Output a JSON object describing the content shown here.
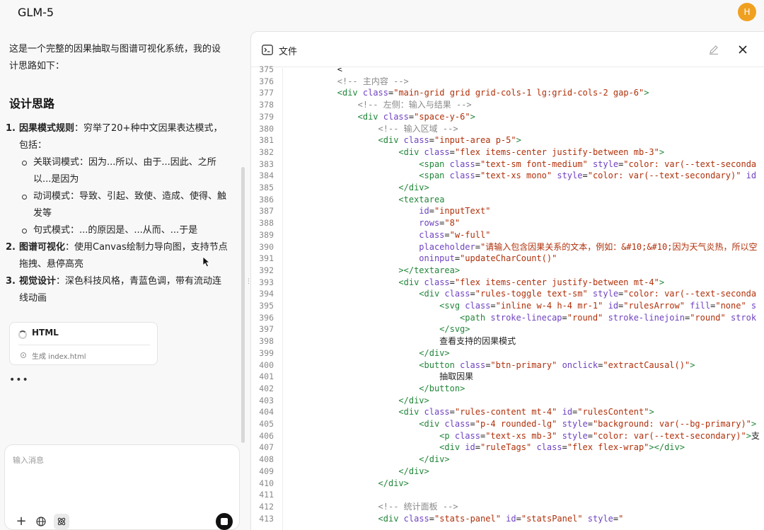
{
  "app": {
    "title": "GLM-5",
    "avatar_letter": "H"
  },
  "chat": {
    "intro": "这是一个完整的因果抽取与图谱可视化系统，我的设计思路如下：",
    "heading": "设计思路",
    "items": [
      {
        "num": "1.",
        "title": "因果模式规则",
        "text": "：穷举了20+种中文因果表达模式，包括：",
        "subs": [
          "关联词模式：因为...所以、由于...因此、之所以...是因为",
          "动词模式：导致、引起、致使、造成、使得、触发等",
          "句式模式：...的原因是、...从而、...于是"
        ]
      },
      {
        "num": "2.",
        "title": "图谱可视化",
        "text": "：使用Canvas绘制力导向图，支持节点拖拽、悬停高亮",
        "subs": []
      },
      {
        "num": "3.",
        "title": "视觉设计",
        "text": "：深色科技风格，青蓝色调，带有流动连线动画",
        "subs": []
      }
    ],
    "card": {
      "title": "HTML",
      "status": "生成 index.html"
    },
    "typing": "•••",
    "input_placeholder": "输入消息"
  },
  "panel": {
    "title": "文件",
    "lines": [
      {
        "n": "375",
        "indent": 8,
        "tokens": [
          [
            "c-txt",
            "<"
          ]
        ]
      },
      {
        "n": "376",
        "indent": 8,
        "tokens": [
          [
            "c-com",
            "<!-- 主内容 -->"
          ]
        ]
      },
      {
        "n": "377",
        "indent": 8,
        "tokens": [
          [
            "c-tag",
            "<div "
          ],
          [
            "c-attr",
            "class"
          ],
          [
            "c-txt",
            "="
          ],
          [
            "c-str",
            "\"main-grid grid grid-cols-1 lg:grid-cols-2 gap-6\""
          ],
          [
            "c-tag",
            ">"
          ]
        ]
      },
      {
        "n": "378",
        "indent": 12,
        "tokens": [
          [
            "c-com",
            "<!-- 左侧：输入与结果 -->"
          ]
        ]
      },
      {
        "n": "379",
        "indent": 12,
        "tokens": [
          [
            "c-tag",
            "<div "
          ],
          [
            "c-attr",
            "class"
          ],
          [
            "c-txt",
            "="
          ],
          [
            "c-str",
            "\"space-y-6\""
          ],
          [
            "c-tag",
            ">"
          ]
        ]
      },
      {
        "n": "380",
        "indent": 16,
        "tokens": [
          [
            "c-com",
            "<!-- 输入区域 -->"
          ]
        ]
      },
      {
        "n": "381",
        "indent": 16,
        "tokens": [
          [
            "c-tag",
            "<div "
          ],
          [
            "c-attr",
            "class"
          ],
          [
            "c-txt",
            "="
          ],
          [
            "c-str",
            "\"input-area p-5\""
          ],
          [
            "c-tag",
            ">"
          ]
        ]
      },
      {
        "n": "382",
        "indent": 20,
        "tokens": [
          [
            "c-tag",
            "<div "
          ],
          [
            "c-attr",
            "class"
          ],
          [
            "c-txt",
            "="
          ],
          [
            "c-str",
            "\"flex items-center justify-between mb-3\""
          ],
          [
            "c-tag",
            ">"
          ]
        ]
      },
      {
        "n": "383",
        "indent": 24,
        "tokens": [
          [
            "c-tag",
            "<span "
          ],
          [
            "c-attr",
            "class"
          ],
          [
            "c-txt",
            "="
          ],
          [
            "c-str",
            "\"text-sm font-medium\" "
          ],
          [
            "c-attr",
            "style"
          ],
          [
            "c-txt",
            "="
          ],
          [
            "c-str",
            "\"color: var(--text-seconda"
          ]
        ]
      },
      {
        "n": "384",
        "indent": 24,
        "tokens": [
          [
            "c-tag",
            "<span "
          ],
          [
            "c-attr",
            "class"
          ],
          [
            "c-txt",
            "="
          ],
          [
            "c-str",
            "\"text-xs mono\" "
          ],
          [
            "c-attr",
            "style"
          ],
          [
            "c-txt",
            "="
          ],
          [
            "c-str",
            "\"color: var(--text-secondary)\" "
          ],
          [
            "c-attr",
            "id"
          ]
        ]
      },
      {
        "n": "385",
        "indent": 20,
        "tokens": [
          [
            "c-tag",
            "</div>"
          ]
        ]
      },
      {
        "n": "386",
        "indent": 20,
        "tokens": [
          [
            "c-tag",
            "<textarea"
          ]
        ]
      },
      {
        "n": "387",
        "indent": 24,
        "tokens": [
          [
            "c-attr",
            "id"
          ],
          [
            "c-txt",
            "="
          ],
          [
            "c-str",
            "\"inputText\""
          ]
        ]
      },
      {
        "n": "388",
        "indent": 24,
        "tokens": [
          [
            "c-attr",
            "rows"
          ],
          [
            "c-txt",
            "="
          ],
          [
            "c-str",
            "\"8\""
          ]
        ]
      },
      {
        "n": "389",
        "indent": 24,
        "tokens": [
          [
            "c-attr",
            "class"
          ],
          [
            "c-txt",
            "="
          ],
          [
            "c-str",
            "\"w-full\""
          ]
        ]
      },
      {
        "n": "390",
        "indent": 24,
        "tokens": [
          [
            "c-attr",
            "placeholder"
          ],
          [
            "c-txt",
            "="
          ],
          [
            "c-str",
            "\"请输入包含因果关系的文本，例如：&#10;&#10;因为天气炎热，所以空"
          ]
        ]
      },
      {
        "n": "391",
        "indent": 24,
        "tokens": [
          [
            "c-attr",
            "oninput"
          ],
          [
            "c-txt",
            "="
          ],
          [
            "c-str",
            "\"updateCharCount()\""
          ]
        ]
      },
      {
        "n": "392",
        "indent": 20,
        "tokens": [
          [
            "c-tag",
            "></textarea>"
          ]
        ]
      },
      {
        "n": "393",
        "indent": 20,
        "tokens": [
          [
            "c-tag",
            "<div "
          ],
          [
            "c-attr",
            "class"
          ],
          [
            "c-txt",
            "="
          ],
          [
            "c-str",
            "\"flex items-center justify-between mt-4\""
          ],
          [
            "c-tag",
            ">"
          ]
        ]
      },
      {
        "n": "394",
        "indent": 24,
        "tokens": [
          [
            "c-tag",
            "<div "
          ],
          [
            "c-attr",
            "class"
          ],
          [
            "c-txt",
            "="
          ],
          [
            "c-str",
            "\"rules-toggle text-sm\" "
          ],
          [
            "c-attr",
            "style"
          ],
          [
            "c-txt",
            "="
          ],
          [
            "c-str",
            "\"color: var(--text-seconda"
          ]
        ]
      },
      {
        "n": "395",
        "indent": 28,
        "tokens": [
          [
            "c-tag",
            "<svg "
          ],
          [
            "c-attr",
            "class"
          ],
          [
            "c-txt",
            "="
          ],
          [
            "c-str",
            "\"inline w-4 h-4 mr-1\" "
          ],
          [
            "c-attr",
            "id"
          ],
          [
            "c-txt",
            "="
          ],
          [
            "c-str",
            "\"rulesArrow\" "
          ],
          [
            "c-attr",
            "fill"
          ],
          [
            "c-txt",
            "="
          ],
          [
            "c-str",
            "\"none\" "
          ],
          [
            "c-attr",
            "s"
          ]
        ]
      },
      {
        "n": "396",
        "indent": 32,
        "tokens": [
          [
            "c-tag",
            "<path "
          ],
          [
            "c-attr",
            "stroke-linecap"
          ],
          [
            "c-txt",
            "="
          ],
          [
            "c-str",
            "\"round\" "
          ],
          [
            "c-attr",
            "stroke-linejoin"
          ],
          [
            "c-txt",
            "="
          ],
          [
            "c-str",
            "\"round\" "
          ],
          [
            "c-attr",
            "strok"
          ]
        ]
      },
      {
        "n": "397",
        "indent": 28,
        "tokens": [
          [
            "c-tag",
            "</svg>"
          ]
        ]
      },
      {
        "n": "398",
        "indent": 28,
        "tokens": [
          [
            "c-txt",
            "查看支持的因果模式"
          ]
        ]
      },
      {
        "n": "399",
        "indent": 24,
        "tokens": [
          [
            "c-tag",
            "</div>"
          ]
        ]
      },
      {
        "n": "400",
        "indent": 24,
        "tokens": [
          [
            "c-tag",
            "<button "
          ],
          [
            "c-attr",
            "class"
          ],
          [
            "c-txt",
            "="
          ],
          [
            "c-str",
            "\"btn-primary\" "
          ],
          [
            "c-attr",
            "onclick"
          ],
          [
            "c-txt",
            "="
          ],
          [
            "c-str",
            "\"extractCausal()\""
          ],
          [
            "c-tag",
            ">"
          ]
        ]
      },
      {
        "n": "401",
        "indent": 28,
        "tokens": [
          [
            "c-txt",
            "抽取因果"
          ]
        ]
      },
      {
        "n": "402",
        "indent": 24,
        "tokens": [
          [
            "c-tag",
            "</button>"
          ]
        ]
      },
      {
        "n": "403",
        "indent": 20,
        "tokens": [
          [
            "c-tag",
            "</div>"
          ]
        ]
      },
      {
        "n": "404",
        "indent": 20,
        "tokens": [
          [
            "c-tag",
            "<div "
          ],
          [
            "c-attr",
            "class"
          ],
          [
            "c-txt",
            "="
          ],
          [
            "c-str",
            "\"rules-content mt-4\" "
          ],
          [
            "c-attr",
            "id"
          ],
          [
            "c-txt",
            "="
          ],
          [
            "c-str",
            "\"rulesContent\""
          ],
          [
            "c-tag",
            ">"
          ]
        ]
      },
      {
        "n": "405",
        "indent": 24,
        "tokens": [
          [
            "c-tag",
            "<div "
          ],
          [
            "c-attr",
            "class"
          ],
          [
            "c-txt",
            "="
          ],
          [
            "c-str",
            "\"p-4 rounded-lg\" "
          ],
          [
            "c-attr",
            "style"
          ],
          [
            "c-txt",
            "="
          ],
          [
            "c-str",
            "\"background: var(--bg-primary)\""
          ],
          [
            "c-tag",
            ">"
          ]
        ]
      },
      {
        "n": "406",
        "indent": 28,
        "tokens": [
          [
            "c-tag",
            "<p "
          ],
          [
            "c-attr",
            "class"
          ],
          [
            "c-txt",
            "="
          ],
          [
            "c-str",
            "\"text-xs mb-3\" "
          ],
          [
            "c-attr",
            "style"
          ],
          [
            "c-txt",
            "="
          ],
          [
            "c-str",
            "\"color: var(--text-secondary)\""
          ],
          [
            "c-tag",
            ">"
          ],
          [
            "c-txt",
            "支"
          ]
        ]
      },
      {
        "n": "407",
        "indent": 28,
        "tokens": [
          [
            "c-tag",
            "<div "
          ],
          [
            "c-attr",
            "id"
          ],
          [
            "c-txt",
            "="
          ],
          [
            "c-str",
            "\"ruleTags\" "
          ],
          [
            "c-attr",
            "class"
          ],
          [
            "c-txt",
            "="
          ],
          [
            "c-str",
            "\"flex flex-wrap\""
          ],
          [
            "c-tag",
            "></div>"
          ]
        ]
      },
      {
        "n": "408",
        "indent": 24,
        "tokens": [
          [
            "c-tag",
            "</div>"
          ]
        ]
      },
      {
        "n": "409",
        "indent": 20,
        "tokens": [
          [
            "c-tag",
            "</div>"
          ]
        ]
      },
      {
        "n": "410",
        "indent": 16,
        "tokens": [
          [
            "c-tag",
            "</div>"
          ]
        ]
      },
      {
        "n": "411",
        "indent": 0,
        "tokens": []
      },
      {
        "n": "412",
        "indent": 16,
        "tokens": [
          [
            "c-com",
            "<!-- 统计面板 -->"
          ]
        ]
      },
      {
        "n": "413",
        "indent": 16,
        "tokens": [
          [
            "c-tag",
            "<div "
          ],
          [
            "c-attr",
            "class"
          ],
          [
            "c-txt",
            "="
          ],
          [
            "c-str",
            "\"stats-panel\" "
          ],
          [
            "c-attr",
            "id"
          ],
          [
            "c-txt",
            "="
          ],
          [
            "c-str",
            "\"statsPanel\" "
          ],
          [
            "c-attr",
            "style"
          ],
          [
            "c-txt",
            "="
          ],
          [
            "c-str",
            "\""
          ]
        ]
      }
    ]
  }
}
